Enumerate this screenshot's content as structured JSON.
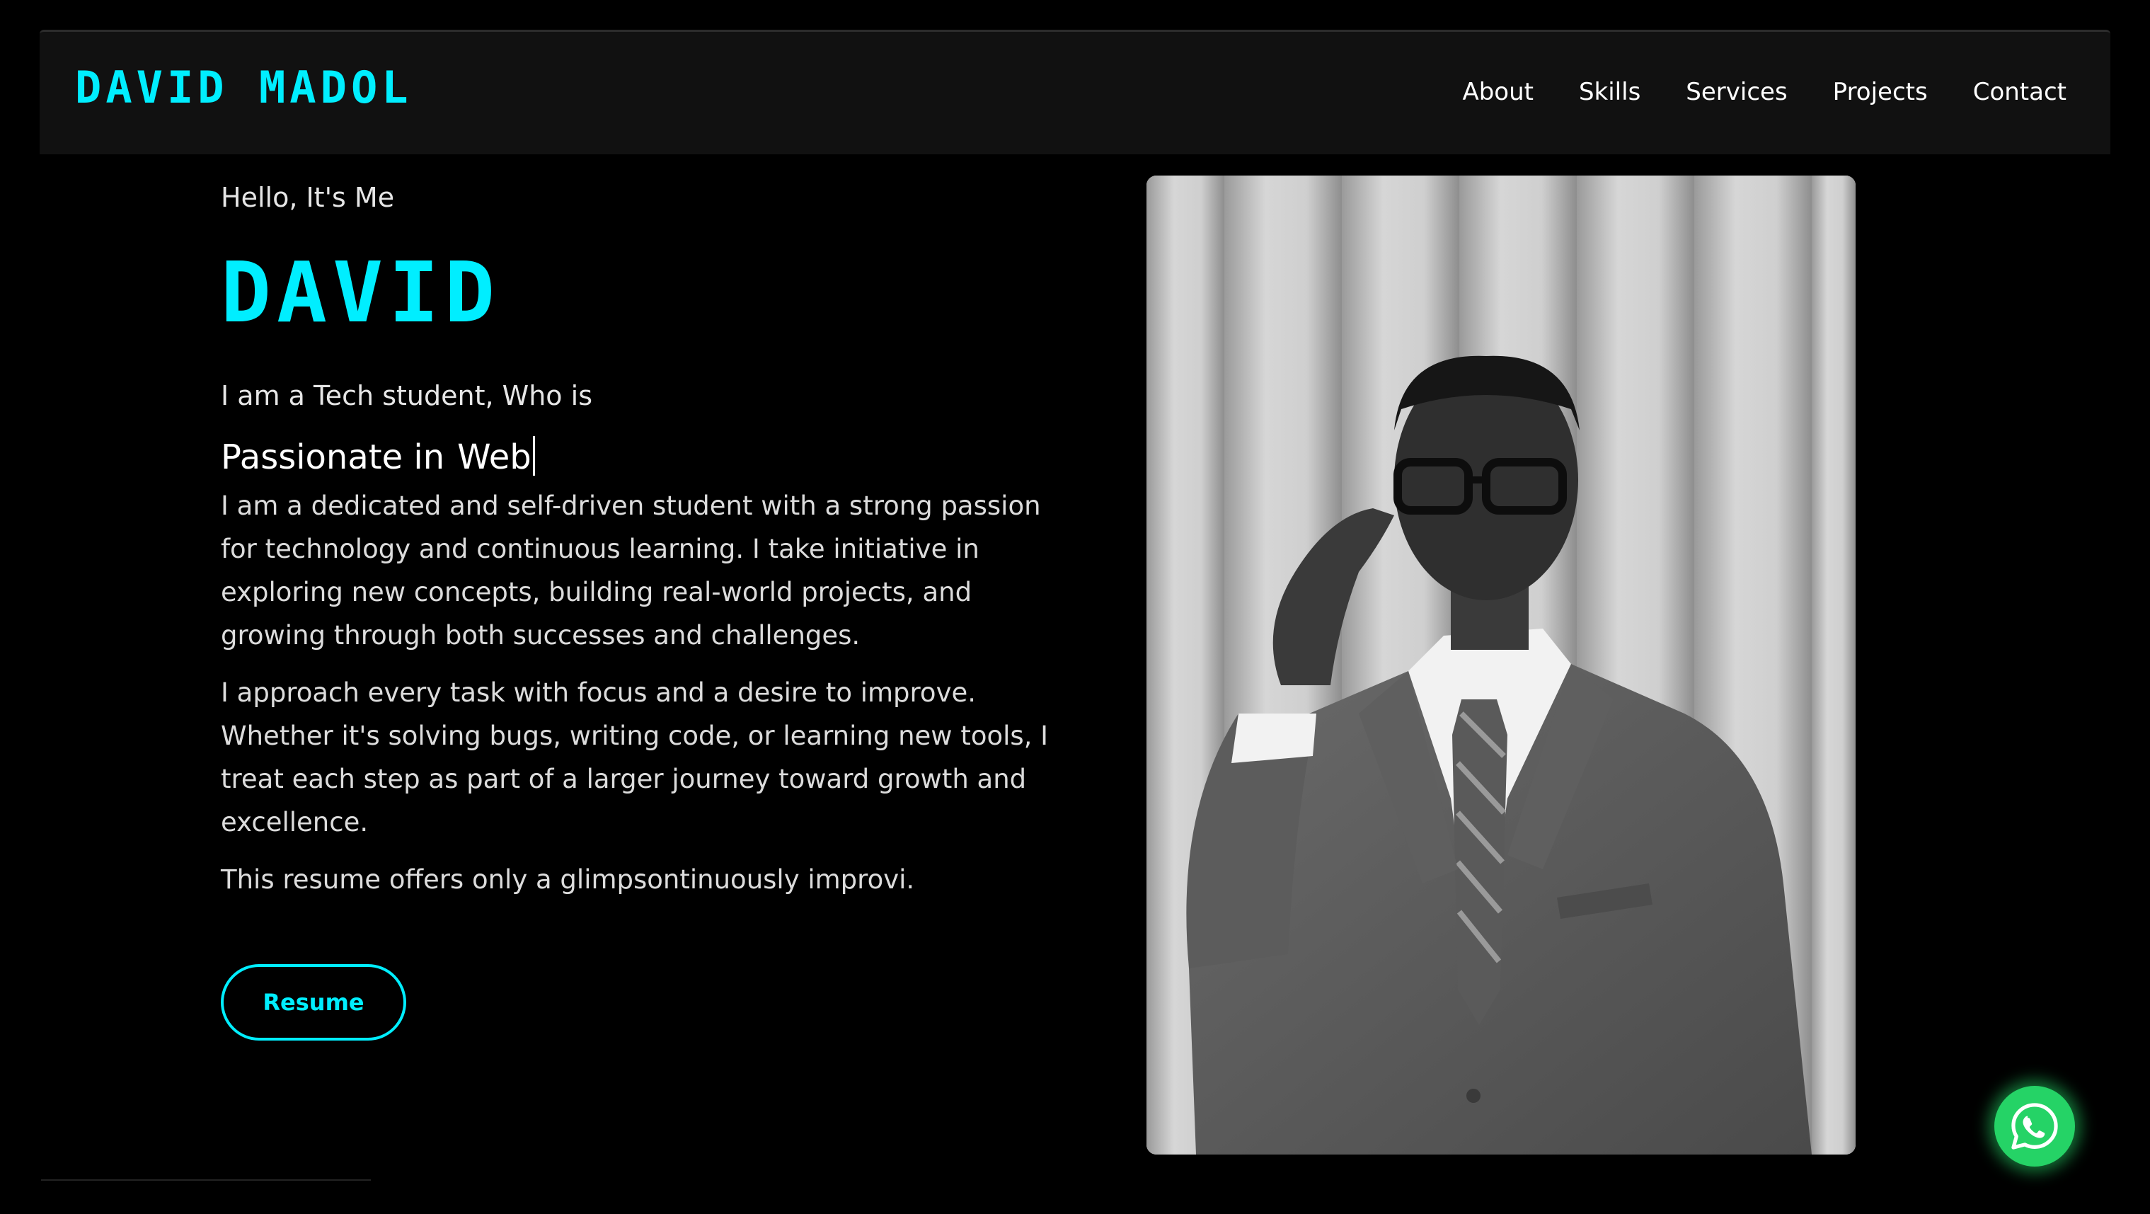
{
  "header": {
    "brand": "DAVID MADOL",
    "nav": [
      "About",
      "Skills",
      "Services",
      "Projects",
      "Contact"
    ]
  },
  "hero": {
    "greeting": "Hello, It's Me",
    "name": "DAVID",
    "tagline": "I am a Tech student, Who is",
    "passion_prefix": "Passionate in",
    "passion_typed": "Web",
    "bio": [
      "I am a dedicated and self-driven student with a strong passion for technology and continuous learning. I take initiative in exploring new concepts, building real-world projects, and growing through both successes and challenges.",
      "I approach every task with focus and a desire to improve. Whether it's solving bugs, writing code, or learning new tools, I treat each step as part of a larger journey toward growth and excellence.",
      "This resume offers only a glimpsontinuously improvi."
    ],
    "resume_label": "Resume"
  },
  "portrait": {
    "icon": "portrait-photo"
  },
  "whatsapp": {
    "icon": "whatsapp-icon"
  },
  "colors": {
    "accent": "#00eeff",
    "background": "#000000",
    "navbar": "#111111",
    "whatsapp": "#25d366"
  }
}
